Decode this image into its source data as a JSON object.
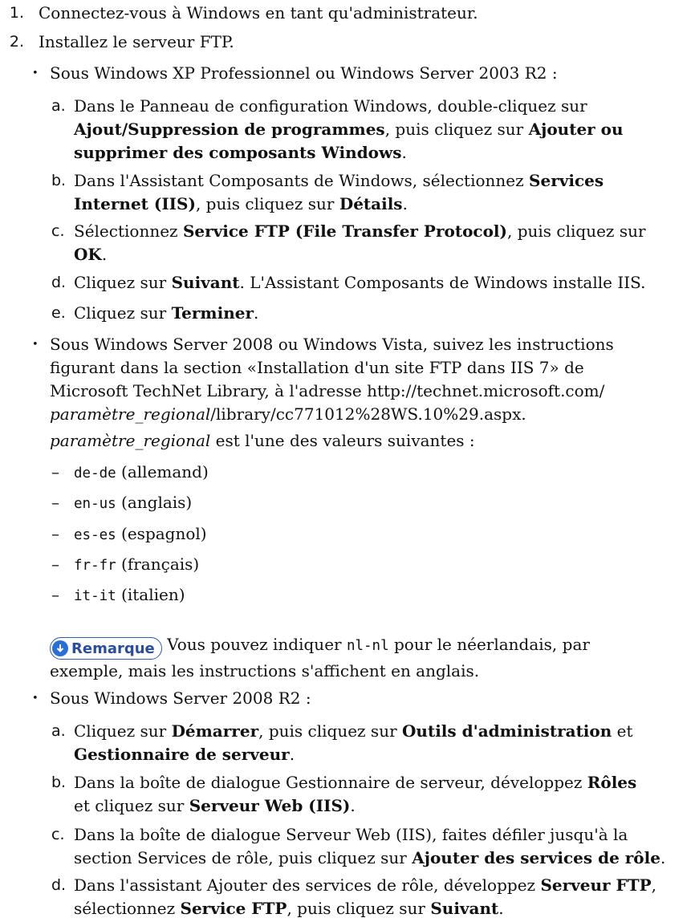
{
  "steps": [
    {
      "marker": "1.",
      "text": "Connectez-vous à Windows en tant qu'administrateur."
    },
    {
      "marker": "2.",
      "text": "Installez le serveur FTP."
    }
  ],
  "bullet_marker": "•",
  "xp": {
    "intro": "Sous Windows XP Professionnel ou Windows Server 2003 R2 :",
    "a": {
      "marker": "a.",
      "t1": "Dans le Panneau de configuration Windows, double-cliquez sur",
      "b1": "Ajout/Suppression de programmes",
      "t2": ", puis cliquez sur",
      "b2a": "Ajouter ou",
      "b2b": "supprimer des composants Windows",
      "t3": "."
    },
    "b": {
      "marker": "b.",
      "t1": "Dans l'Assistant Composants de Windows, sélectionnez",
      "b1a": "Services",
      "b1b": "Internet (IIS)",
      "t2": ", puis cliquez sur",
      "b2": "Détails",
      "t3": "."
    },
    "c": {
      "marker": "c.",
      "t1": "Sélectionnez",
      "b1": "Service FTP (File Transfer Protocol)",
      "t2": ", puis cliquez sur",
      "b2": "OK",
      "t3": "."
    },
    "d": {
      "marker": "d.",
      "t1": "Cliquez sur",
      "b1": "Suivant",
      "t2": ". L'Assistant Composants de Windows installe IIS."
    },
    "e": {
      "marker": "e.",
      "t1": "Cliquez sur",
      "b1": "Terminer",
      "t2": "."
    }
  },
  "vista": {
    "line1": "Sous Windows Server 2008 ou Windows Vista, suivez les instructions",
    "line2": "figurant dans la section «Installation d'un site FTP dans IIS 7» de",
    "line3": "Microsoft TechNet Library, à l'adresse http://technet.microsoft.com/",
    "line4_em": "paramètre_regional",
    "line4_rest": "/library/cc771012%28WS.10%29.aspx.",
    "locale_em": "paramètre_regional",
    "locale_rest": " est l'une des valeurs suivantes :",
    "dash_marker": "–",
    "locales": [
      {
        "code": "de-de",
        "lang": " (allemand)"
      },
      {
        "code": "en-us",
        "lang": " (anglais)"
      },
      {
        "code": "es-es",
        "lang": " (espagnol)"
      },
      {
        "code": "fr-fr",
        "lang": " (français)"
      },
      {
        "code": "it-it",
        "lang": " (italien)"
      }
    ],
    "remark_label": "Remarque",
    "remark_t1": " Vous pouvez indiquer ",
    "remark_code": "nl-nl",
    "remark_t2": " pour le néerlandais, par",
    "remark_t3": "exemple, mais les instructions s'affichent en anglais."
  },
  "r2": {
    "intro": "Sous Windows Server 2008 R2 :",
    "a": {
      "marker": "a.",
      "t1": "Cliquez sur",
      "b1": "Démarrer",
      "t2": ", puis cliquez sur",
      "b2": "Outils d'administration",
      "t3": " et",
      "b3": "Gestionnaire de serveur",
      "t4": "."
    },
    "b": {
      "marker": "b.",
      "t1": "Dans la boîte de dialogue Gestionnaire de serveur, développez",
      "b1": "Rôles",
      "t2": "et cliquez sur",
      "b2": "Serveur Web (IIS)",
      "t3": "."
    },
    "c": {
      "marker": "c.",
      "t1": "Dans la boîte de dialogue Serveur Web (IIS), faites défiler jusqu'à la",
      "t2": "section Services de rôle, puis cliquez sur",
      "b1": "Ajouter des services de rôle",
      "t3": "."
    },
    "d": {
      "marker": "d.",
      "t1": "Dans l'assistant Ajouter des services de rôle, développez",
      "b1": "Serveur FTP",
      "t2": ",",
      "t3": "sélectionnez",
      "b2": "Service FTP",
      "t4": ", puis cliquez sur",
      "b3": "Suivant",
      "t5": "."
    }
  }
}
